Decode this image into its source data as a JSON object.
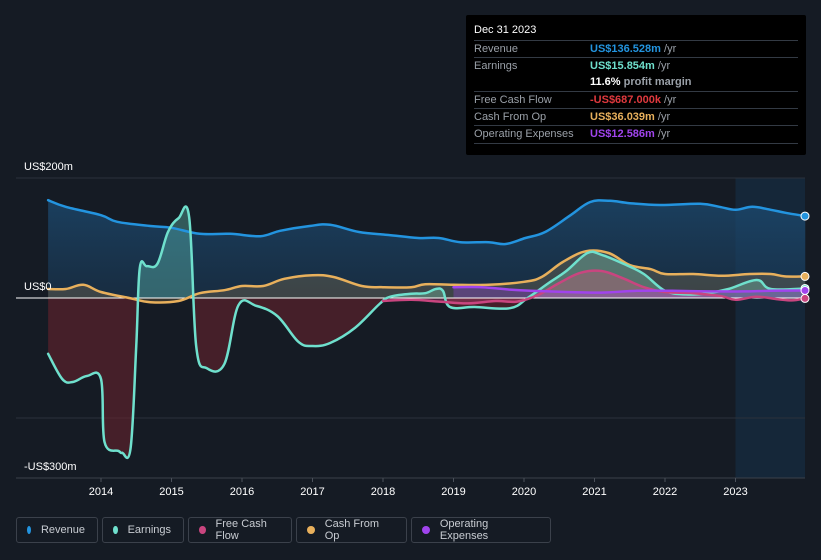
{
  "tooltip": {
    "date": "Dec 31 2023",
    "rows": [
      {
        "label": "Revenue",
        "value": "US$136.528m",
        "unit": "/yr",
        "color": "#2394df"
      },
      {
        "label": "Earnings",
        "value": "US$15.854m",
        "unit": "/yr",
        "color": "#6fe0cd"
      },
      {
        "label": "",
        "margin_value": "11.6%",
        "margin_text": "profit margin"
      },
      {
        "label": "Free Cash Flow",
        "value": "-US$687.000k",
        "unit": "/yr",
        "color": "#e0393e"
      },
      {
        "label": "Cash From Op",
        "value": "US$36.039m",
        "unit": "/yr",
        "color": "#e8b05c"
      },
      {
        "label": "Operating Expenses",
        "value": "US$12.586m",
        "unit": "/yr",
        "color": "#a044ed"
      }
    ]
  },
  "legend": [
    {
      "label": "Revenue",
      "color": "#2394df"
    },
    {
      "label": "Earnings",
      "color": "#6fe0cd"
    },
    {
      "label": "Free Cash Flow",
      "color": "#c9457f"
    },
    {
      "label": "Cash From Op",
      "color": "#e8b05c"
    },
    {
      "label": "Operating Expenses",
      "color": "#a044ed"
    }
  ],
  "chart_data": {
    "type": "area",
    "title": "",
    "xlabel": "",
    "ylabel": "",
    "ylim": [
      -300,
      200
    ],
    "xlim": [
      2013.25,
      2023.99
    ],
    "y_tick_labels": [
      {
        "value": 200,
        "label": "US$200m"
      },
      {
        "value": 0,
        "label": "US$0"
      },
      {
        "value": -300,
        "label": "-US$300m"
      }
    ],
    "gridlines": [
      200,
      -200,
      -300
    ],
    "x_ticks": [
      2014,
      2015,
      2016,
      2017,
      2018,
      2019,
      2020,
      2021,
      2022,
      2023
    ],
    "forecast_shade_from": 2023,
    "series": [
      {
        "name": "Revenue",
        "color": "#2394df",
        "points": [
          [
            2013.25,
            163
          ],
          [
            2013.5,
            152
          ],
          [
            2014,
            138
          ],
          [
            2014.23,
            127
          ],
          [
            2014.7,
            120
          ],
          [
            2015,
            117
          ],
          [
            2015.4,
            107
          ],
          [
            2015.83,
            107
          ],
          [
            2016.26,
            103
          ],
          [
            2016.54,
            112
          ],
          [
            2016.96,
            120
          ],
          [
            2017.25,
            122
          ],
          [
            2017.66,
            110
          ],
          [
            2018.08,
            105
          ],
          [
            2018.5,
            100
          ],
          [
            2018.79,
            100
          ],
          [
            2019.1,
            93
          ],
          [
            2019.5,
            93
          ],
          [
            2019.74,
            90
          ],
          [
            2020.02,
            100
          ],
          [
            2020.3,
            110
          ],
          [
            2020.66,
            138
          ],
          [
            2020.94,
            160
          ],
          [
            2021.22,
            162
          ],
          [
            2021.5,
            158
          ],
          [
            2021.93,
            155
          ],
          [
            2022.5,
            157
          ],
          [
            2022.77,
            152
          ],
          [
            2023,
            147
          ],
          [
            2023.24,
            152
          ],
          [
            2023.5,
            147
          ],
          [
            2023.71,
            142
          ],
          [
            2023.99,
            136.5
          ]
        ]
      },
      {
        "name": "Earnings",
        "color": "#6fe0cd",
        "points": [
          [
            2013.25,
            -93
          ],
          [
            2013.45,
            -135
          ],
          [
            2013.6,
            -140
          ],
          [
            2013.8,
            -130
          ],
          [
            2014,
            -135
          ],
          [
            2014.05,
            -240
          ],
          [
            2014.25,
            -255
          ],
          [
            2014.3,
            -258
          ],
          [
            2014.42,
            -250
          ],
          [
            2014.5,
            -80
          ],
          [
            2014.55,
            50
          ],
          [
            2014.65,
            53
          ],
          [
            2014.8,
            57
          ],
          [
            2014.95,
            110
          ],
          [
            2015.1,
            133
          ],
          [
            2015.25,
            135
          ],
          [
            2015.35,
            -80
          ],
          [
            2015.5,
            -117
          ],
          [
            2015.75,
            -110
          ],
          [
            2015.95,
            -12
          ],
          [
            2016.2,
            -13
          ],
          [
            2016.5,
            -30
          ],
          [
            2016.8,
            -73
          ],
          [
            2017.0,
            -80
          ],
          [
            2017.25,
            -75
          ],
          [
            2017.6,
            -50
          ],
          [
            2017.95,
            -10
          ],
          [
            2018.1,
            2
          ],
          [
            2018.4,
            7
          ],
          [
            2018.6,
            8
          ],
          [
            2018.75,
            15
          ],
          [
            2018.85,
            12
          ],
          [
            2018.95,
            -15
          ],
          [
            2019.3,
            -15
          ],
          [
            2019.8,
            -17
          ],
          [
            2020.05,
            0
          ],
          [
            2020.35,
            25
          ],
          [
            2020.6,
            45
          ],
          [
            2020.9,
            75
          ],
          [
            2021.1,
            72
          ],
          [
            2021.45,
            55
          ],
          [
            2021.7,
            40
          ],
          [
            2022,
            12
          ],
          [
            2022.3,
            6
          ],
          [
            2022.6,
            8
          ],
          [
            2022.9,
            15
          ],
          [
            2023.3,
            30
          ],
          [
            2023.5,
            15
          ],
          [
            2023.99,
            15.85
          ]
        ]
      },
      {
        "name": "Free Cash Flow",
        "color": "#c9457f",
        "points": [
          [
            2018.0,
            -5
          ],
          [
            2018.4,
            -3
          ],
          [
            2018.8,
            -6
          ],
          [
            2019.2,
            -9
          ],
          [
            2019.6,
            -5
          ],
          [
            2019.9,
            -6
          ],
          [
            2020.2,
            5
          ],
          [
            2020.5,
            25
          ],
          [
            2020.8,
            42
          ],
          [
            2021.1,
            45
          ],
          [
            2021.4,
            33
          ],
          [
            2021.7,
            18
          ],
          [
            2022,
            10
          ],
          [
            2022.4,
            8
          ],
          [
            2022.8,
            3
          ],
          [
            2023,
            -3
          ],
          [
            2023.3,
            2
          ],
          [
            2023.6,
            -2
          ],
          [
            2023.8,
            -4
          ],
          [
            2023.99,
            -0.7
          ]
        ]
      },
      {
        "name": "Cash From Op",
        "color": "#e8b05c",
        "points": [
          [
            2013.25,
            15
          ],
          [
            2013.5,
            15
          ],
          [
            2013.75,
            22
          ],
          [
            2014,
            10
          ],
          [
            2014.4,
            0
          ],
          [
            2014.7,
            -7
          ],
          [
            2015.1,
            -5
          ],
          [
            2015.4,
            8
          ],
          [
            2015.75,
            13
          ],
          [
            2016,
            20
          ],
          [
            2016.3,
            20
          ],
          [
            2016.6,
            32
          ],
          [
            2017,
            38
          ],
          [
            2017.3,
            35
          ],
          [
            2017.7,
            20
          ],
          [
            2018,
            18
          ],
          [
            2018.4,
            18
          ],
          [
            2018.6,
            23
          ],
          [
            2019,
            22
          ],
          [
            2019.5,
            22
          ],
          [
            2020,
            27
          ],
          [
            2020.25,
            35
          ],
          [
            2020.55,
            60
          ],
          [
            2020.88,
            78
          ],
          [
            2021.2,
            75
          ],
          [
            2021.5,
            55
          ],
          [
            2021.8,
            48
          ],
          [
            2022,
            40
          ],
          [
            2022.4,
            40
          ],
          [
            2022.8,
            37
          ],
          [
            2023.2,
            40
          ],
          [
            2023.5,
            40
          ],
          [
            2023.7,
            36
          ],
          [
            2023.99,
            36
          ]
        ]
      },
      {
        "name": "Operating Expenses",
        "color": "#a044ed",
        "points": [
          [
            2019.0,
            18
          ],
          [
            2019.4,
            18
          ],
          [
            2019.8,
            14
          ],
          [
            2020.1,
            12
          ],
          [
            2020.6,
            10
          ],
          [
            2021.1,
            9
          ],
          [
            2021.6,
            12
          ],
          [
            2022.1,
            12
          ],
          [
            2022.6,
            11
          ],
          [
            2023.1,
            11
          ],
          [
            2023.5,
            12
          ],
          [
            2023.99,
            12.6
          ]
        ]
      }
    ]
  }
}
